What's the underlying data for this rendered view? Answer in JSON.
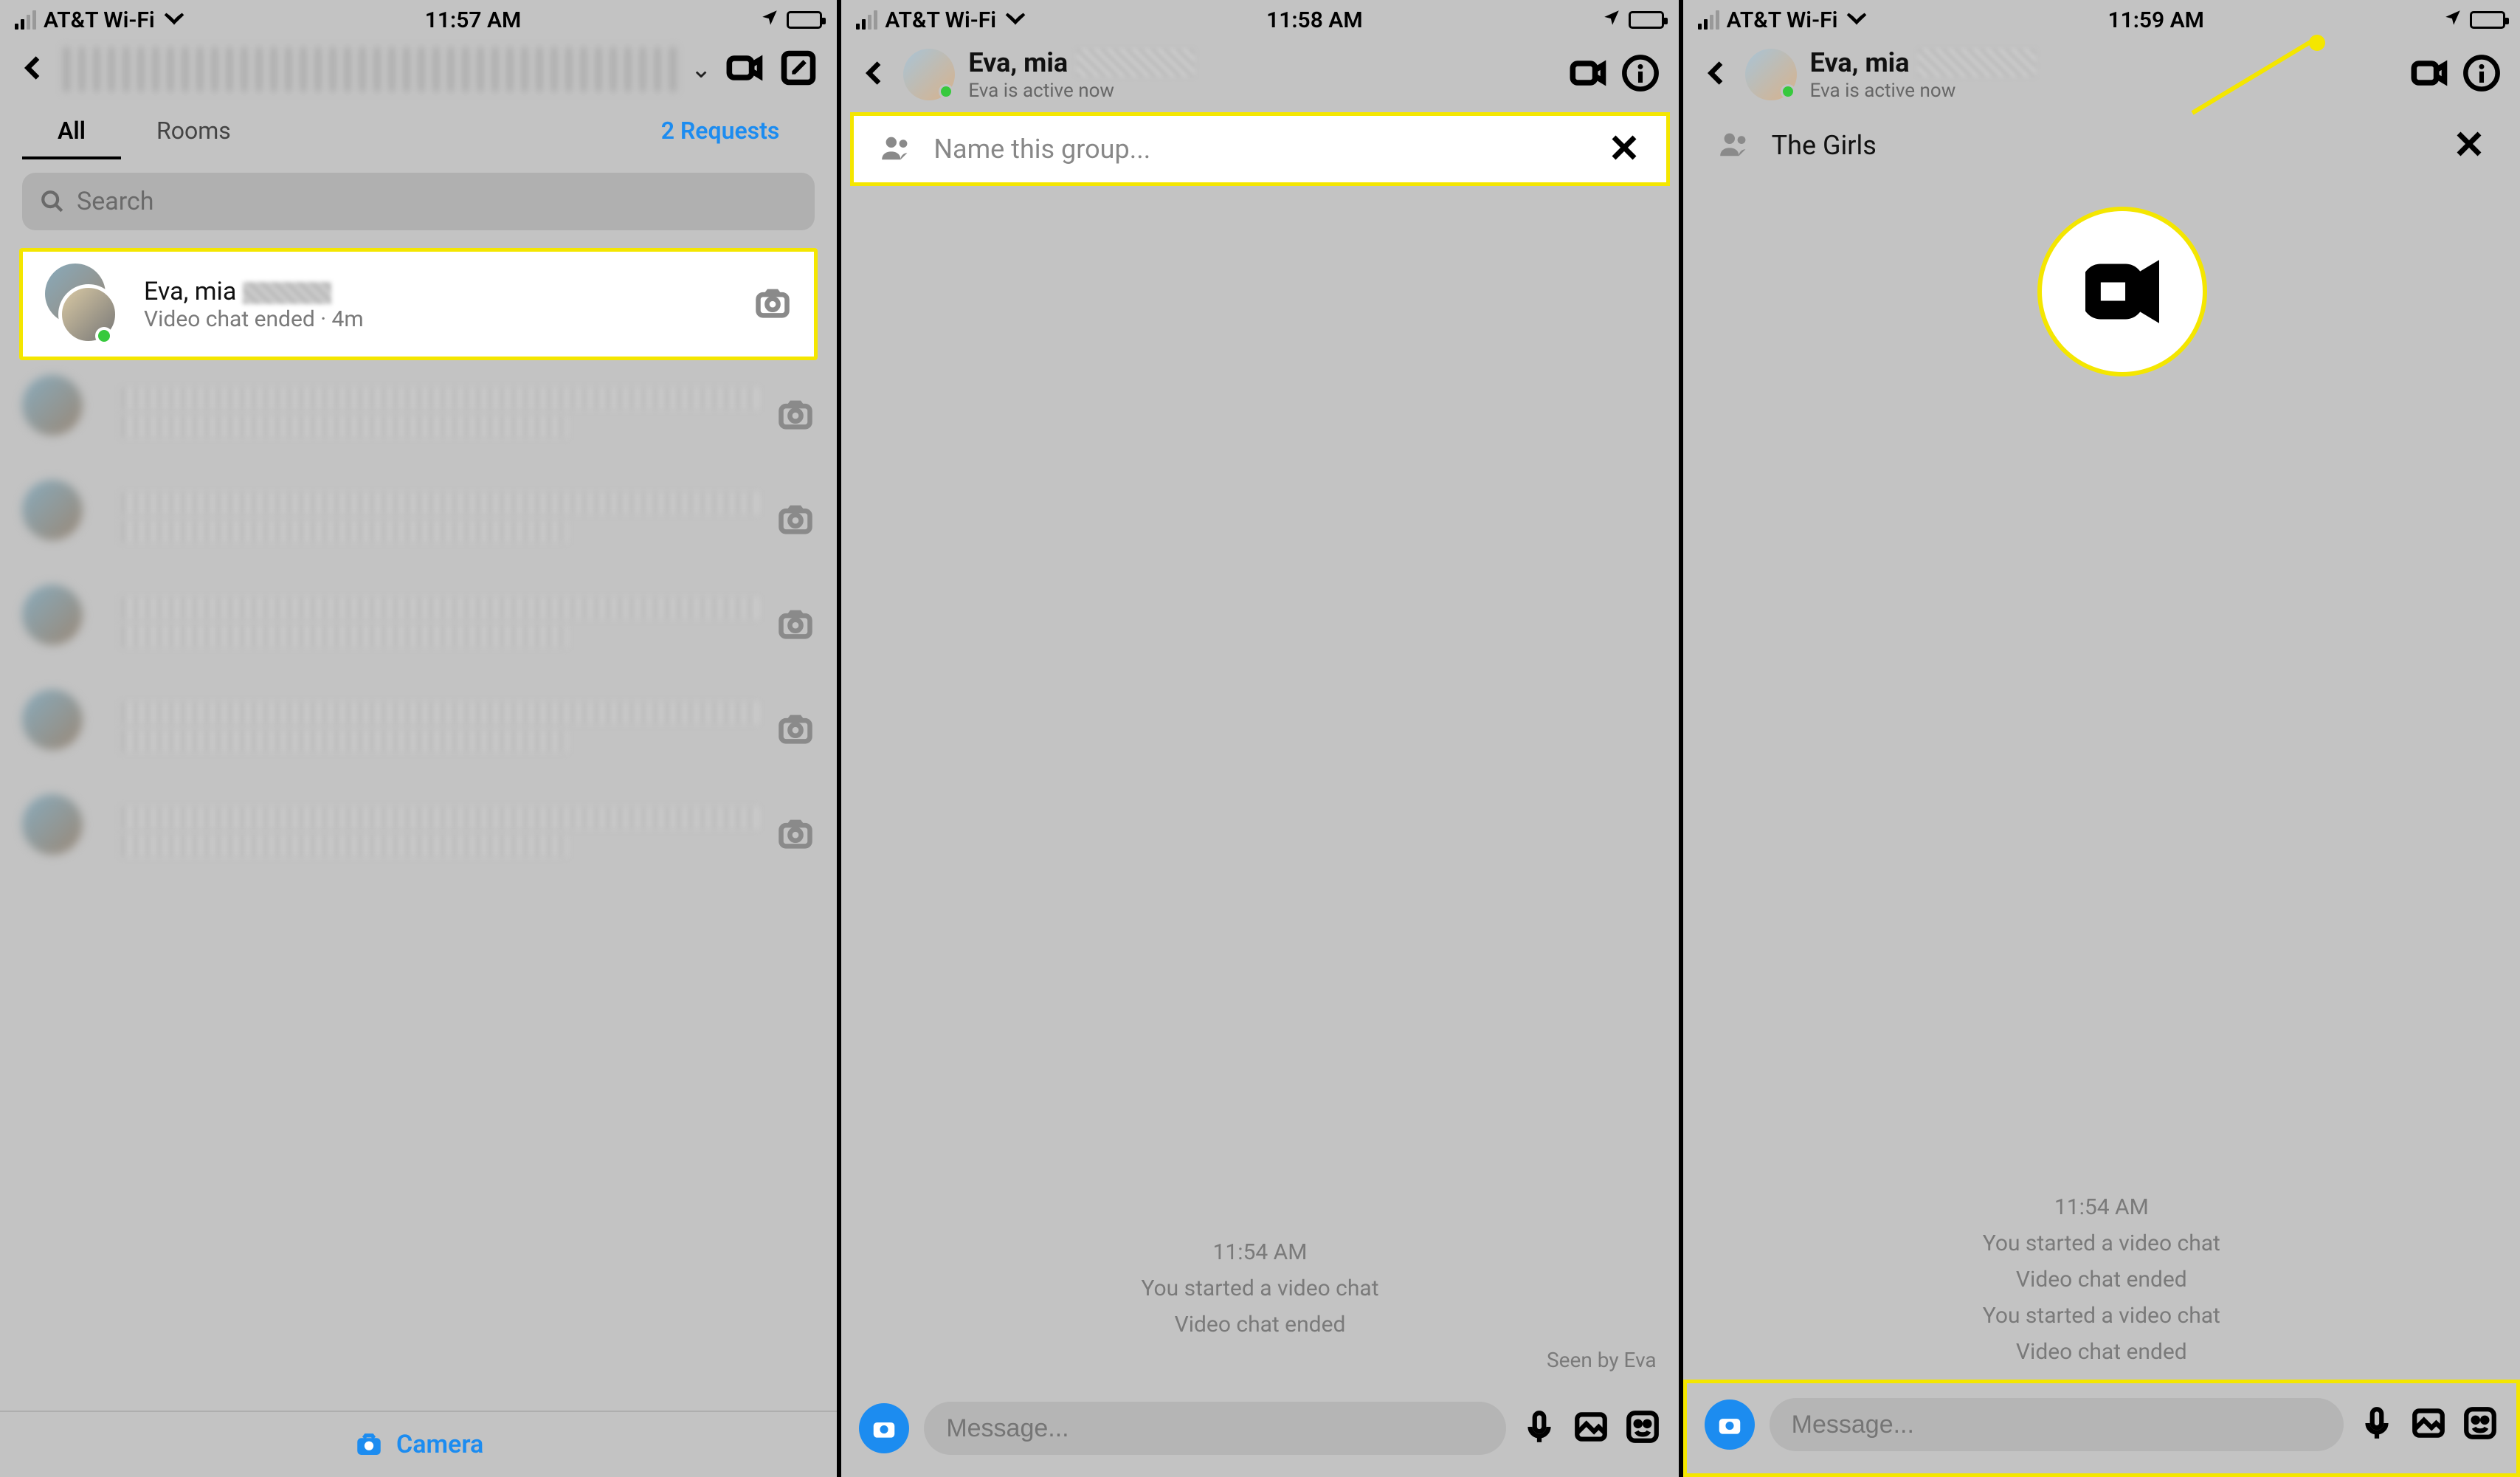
{
  "status": {
    "carrier": "AT&T Wi-Fi",
    "time1": "11:57 AM",
    "time2": "11:58 AM",
    "time3": "11:59 AM"
  },
  "screen1": {
    "tabs": {
      "all": "All",
      "rooms": "Rooms",
      "requests": "2 Requests"
    },
    "search_placeholder": "Search",
    "conv": {
      "name": "Eva, mia",
      "sub": "Video chat ended · 4m"
    },
    "footer_camera": "Camera"
  },
  "screen2": {
    "title": "Eva, mia",
    "subtitle": "Eva is active now",
    "group_placeholder": "Name this group...",
    "messages": {
      "time": "11:54 AM",
      "l1": "You started a video chat",
      "l2": "Video chat ended"
    },
    "seen": "Seen by Eva",
    "composer_placeholder": "Message..."
  },
  "screen3": {
    "title": "Eva, mia",
    "subtitle": "Eva is active now",
    "group_name": "The Girls",
    "messages": {
      "time": "11:54 AM",
      "l1": "You started a video chat",
      "l2": "Video chat ended",
      "l3": "You started a video chat",
      "l4": "Video chat ended"
    },
    "composer_placeholder": "Message..."
  }
}
